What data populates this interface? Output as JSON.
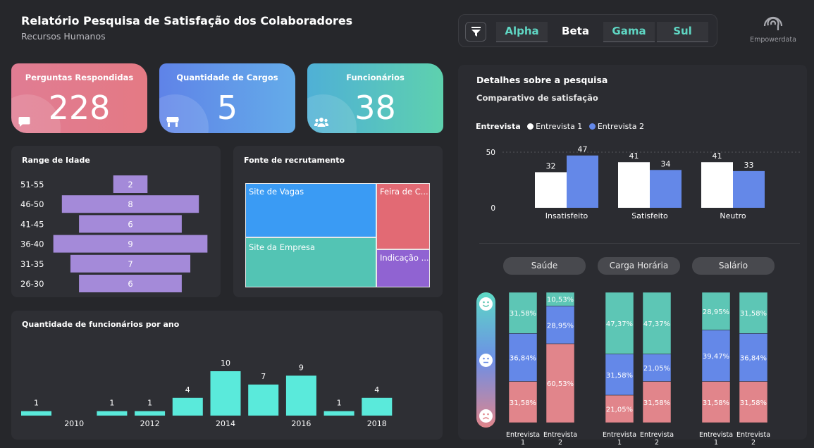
{
  "header": {
    "title": "Relatório Pesquisa de Satisfação dos Colaboradores",
    "subtitle": "Recursos Humanos"
  },
  "filters": {
    "segments": [
      "Alpha",
      "Beta",
      "Gama",
      "Sul"
    ],
    "selected": "Beta"
  },
  "logo": {
    "text": "Empowerdata"
  },
  "kpis": [
    {
      "label": "Perguntas Respondidas",
      "value": "228",
      "icon": "chat-icon"
    },
    {
      "label": "Quantidade de Cargos",
      "value": "5",
      "icon": "store-icon"
    },
    {
      "label": "Funcionários",
      "value": "38",
      "icon": "people-icon"
    }
  ],
  "age": {
    "title": "Range de Idade",
    "rows": [
      {
        "label": "51-55",
        "value": 2
      },
      {
        "label": "46-50",
        "value": 8
      },
      {
        "label": "41-45",
        "value": 6
      },
      {
        "label": "36-40",
        "value": 9
      },
      {
        "label": "31-35",
        "value": 7
      },
      {
        "label": "26-30",
        "value": 6
      }
    ]
  },
  "recruit": {
    "title": "Fonte de recrutamento",
    "cells": [
      {
        "label": "Site de Vagas",
        "color": "#3a9bf4"
      },
      {
        "label": "Site da Empresa",
        "color": "#53c4b4"
      },
      {
        "label": "Feira de C...",
        "color": "#e26a74"
      },
      {
        "label": "Indicação ...",
        "color": "#9063d2"
      }
    ]
  },
  "yearly": {
    "title": "Quantidade de funcionários por ano",
    "bars": [
      {
        "year": "2010",
        "value": 1,
        "show_year": false
      },
      {
        "year": "2010",
        "value": null,
        "show_year": true
      },
      {
        "year": "2011",
        "value": 1,
        "show_year": false
      },
      {
        "year": "2012",
        "value": 1,
        "show_year": true
      },
      {
        "year": "2013",
        "value": 4,
        "show_year": false
      },
      {
        "year": "2014",
        "value": 10,
        "show_year": true
      },
      {
        "year": "2015",
        "value": 7,
        "show_year": false
      },
      {
        "year": "2016",
        "value": 9,
        "show_year": true
      },
      {
        "year": "2017",
        "value": 1,
        "show_year": false
      },
      {
        "year": "2018",
        "value": 4,
        "show_year": true
      }
    ],
    "axis_years": [
      "2010",
      "2012",
      "2014",
      "2016",
      "2018"
    ],
    "color": "#5aeadb"
  },
  "details": {
    "title": "Detalhes sobre a pesquisa",
    "subtitle": "Comparativo de satisfação"
  },
  "chart_data": [
    {
      "type": "bar",
      "legend_title": "Entrevista",
      "categories": [
        "Insatisfeito",
        "Satisfeito",
        "Neutro"
      ],
      "series": [
        {
          "name": "Entrevista 1",
          "values": [
            32,
            41,
            41
          ],
          "color": "#ffffff"
        },
        {
          "name": "Entrevista 2",
          "values": [
            47,
            34,
            33
          ],
          "color": "#6488e8"
        }
      ],
      "yticks": [
        "0",
        "50"
      ],
      "ylim": [
        0,
        55
      ]
    },
    {
      "type": "bar",
      "stacked": "100%",
      "groups": [
        "Saúde",
        "Carga Horária",
        "Salário"
      ],
      "bar_labels": [
        "Entrevista 1",
        "Entrevista 2"
      ],
      "segments_order": [
        "satisfeito",
        "neutro",
        "insatisfeito"
      ],
      "colors": {
        "satisfeito": "#5dc6b5",
        "neutro": "#6488e8",
        "insatisfeito": "#e1858b"
      },
      "values": [
        [
          [
            "31,58%",
            "36,84%",
            "31,58%"
          ],
          [
            "10,53%",
            "28,95%",
            "60,53%"
          ]
        ],
        [
          [
            "47,37%",
            "31,58%",
            "21,05%"
          ],
          [
            "47,37%",
            "21,05%",
            "31,58%"
          ]
        ],
        [
          [
            "28,95%",
            "39,47%",
            "31,58%"
          ],
          [
            "31,58%",
            "36,84%",
            "31,58%"
          ]
        ]
      ]
    }
  ],
  "mood_icons": [
    "happy-face-icon",
    "neutral-face-icon",
    "sad-face-icon"
  ]
}
